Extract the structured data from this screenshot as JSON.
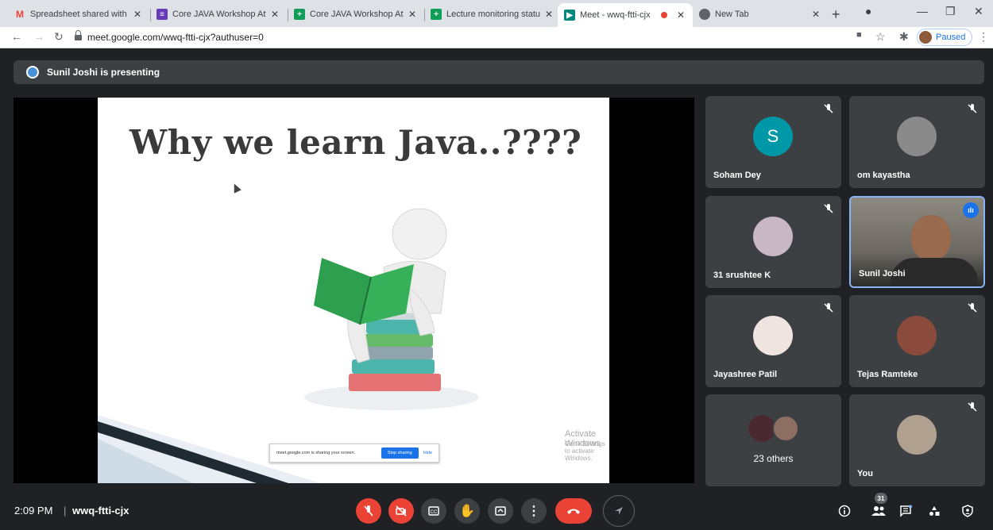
{
  "browser": {
    "tabs": [
      {
        "title": "Spreadsheet shared with yo",
        "icon": "gmail-icon",
        "color": "#ea4335"
      },
      {
        "title": "Core JAVA Workshop Atten",
        "icon": "forms-icon",
        "color": "#673ab7"
      },
      {
        "title": "Core JAVA Workshop Atten",
        "icon": "sheets-icon",
        "color": "#0f9d58"
      },
      {
        "title": "Lecture monitoring status",
        "icon": "sheets-icon",
        "color": "#0f9d58"
      },
      {
        "title": "Meet - wwq-ftti-cjx",
        "icon": "meet-icon",
        "color": "#00897b",
        "active": true
      },
      {
        "title": "New Tab",
        "icon": "chrome-icon",
        "color": "#5f6368"
      }
    ],
    "url": "meet.google.com/wwq-ftti-cjx?authuser=0",
    "profile_status": "Paused"
  },
  "banner": {
    "text": "Sunil Joshi is presenting"
  },
  "slide": {
    "title": "Why we learn Java..????",
    "share_notice": "meet.google.com is sharing your screen.",
    "stop_label": "Stop sharing",
    "hide_label": "Hide",
    "watermark_title": "Activate Windows",
    "watermark_sub": "Go to Settings to activate Windows."
  },
  "participants": [
    {
      "name": "Soham Dey",
      "initial": "S",
      "avatar_color": "#0097a7",
      "muted": true
    },
    {
      "name": "om kayastha",
      "muted": true
    },
    {
      "name": "31 srushtee K",
      "muted": true
    },
    {
      "name": "Sunil Joshi",
      "speaking": true
    },
    {
      "name": "Jayashree Patil",
      "muted": true
    },
    {
      "name": "Tejas Ramteke",
      "muted": true
    },
    {
      "name": "23 others"
    },
    {
      "name": "You",
      "muted": true
    }
  ],
  "bottom_bar": {
    "time": "2:09 PM",
    "separator": "|",
    "meeting_code": "wwq-ftti-cjx",
    "participant_count": "31"
  },
  "colors": {
    "end_call": "#ea4335",
    "muted_red": "#ea4335",
    "accent": "#1a73e8"
  }
}
